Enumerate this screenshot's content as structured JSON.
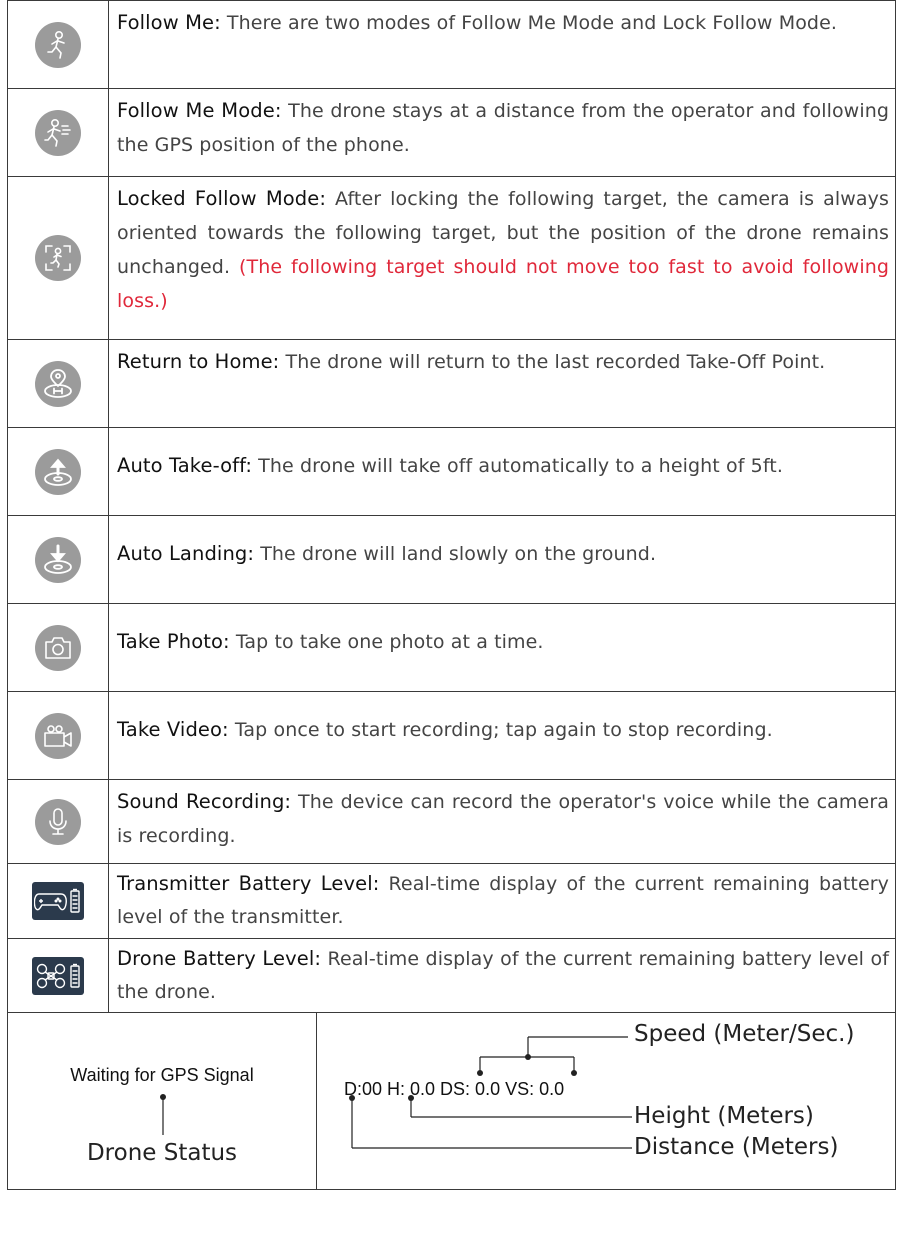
{
  "rows": [
    {
      "icon": "follow-me-icon",
      "term": "Follow Me:",
      "desc": " There are two modes of  Follow Me Mode and Lock Follow Mode."
    },
    {
      "icon": "follow-me-mode-icon",
      "term": "Follow Me Mode:",
      "desc": " The drone stays at a distance from the operator and following the GPS position of the phone."
    },
    {
      "icon": "locked-follow-icon",
      "term": "Locked Follow Mode:",
      "desc": " After locking the following target, the camera is always oriented towards the following target, but the position of the drone remains unchanged. ",
      "warning": "(The following target should not move too fast to avoid following loss.)"
    },
    {
      "icon": "return-home-icon",
      "term": "Return to Home:",
      "desc": " The drone will return to the last recorded Take-Off Point."
    },
    {
      "icon": "auto-takeoff-icon",
      "term": "Auto Take-off:",
      "desc": " The drone will take off automatically to a height of 5ft."
    },
    {
      "icon": "auto-landing-icon",
      "term": "Auto Landing:",
      "desc": " The drone will land slowly on the ground."
    },
    {
      "icon": "camera-icon",
      "term": "Take Photo:",
      "desc": " Tap to take one photo at a time."
    },
    {
      "icon": "video-camera-icon",
      "term": "Take Video:",
      "desc": " Tap once to start recording; tap again to stop recording."
    },
    {
      "icon": "microphone-icon",
      "term": "Sound Recording:",
      "desc": " The device can record the operator's voice while the camera is recording."
    },
    {
      "icon": "transmitter-battery-icon",
      "term": "Transmitter Battery Level:",
      "desc": " Real-time display of the current remaining battery level of the transmitter."
    },
    {
      "icon": "drone-battery-icon",
      "term": "Drone Battery Level:",
      "desc": " Real-time display of the current remaining battery level of the drone."
    }
  ],
  "status": {
    "gps_text": "Waiting for GPS Signal",
    "drone_status_label": "Drone Status",
    "telemetry_text": "D:00 H: 0.0 DS: 0.0 VS: 0.0",
    "speed_label": "Speed (Meter/Sec.)",
    "height_label": "Height (Meters)",
    "distance_label": "Distance (Meters)"
  },
  "colors": {
    "icon_bg": "#9b9b9b",
    "battery_icon_bg": "#2b3a4c",
    "warning": "#e0283a"
  }
}
